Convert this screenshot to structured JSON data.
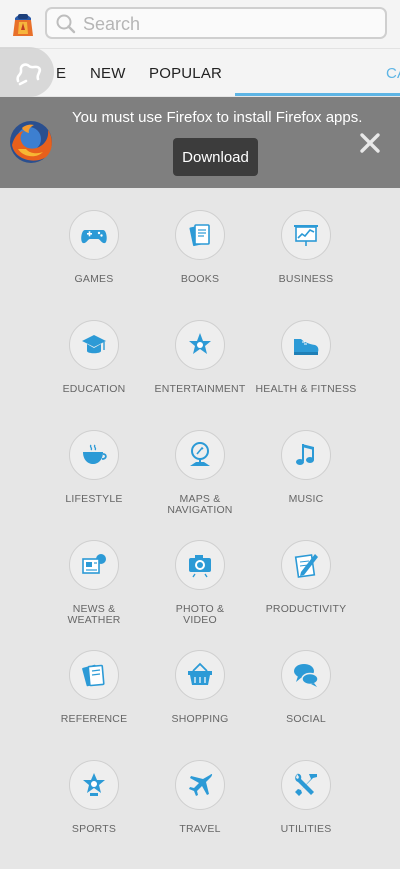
{
  "search": {
    "placeholder": "Search",
    "icon": "search-icon"
  },
  "tabs": [
    {
      "label": "E"
    },
    {
      "label": "NEW"
    },
    {
      "label": "POPULAR"
    },
    {
      "label": "CA"
    }
  ],
  "banner": {
    "message": "You must use Firefox to install Firefox apps.",
    "download_label": "Download"
  },
  "categories": [
    {
      "label": "GAMES",
      "icon": "gamepad-icon"
    },
    {
      "label": "BOOKS",
      "icon": "book-icon"
    },
    {
      "label": "BUSINESS",
      "icon": "chart-icon"
    },
    {
      "label": "EDUCATION",
      "icon": "graduation-cap-icon"
    },
    {
      "label": "ENTERTAINMENT",
      "icon": "star-icon"
    },
    {
      "label": "HEALTH & FITNESS",
      "icon": "sneaker-icon"
    },
    {
      "label": "LIFESTYLE",
      "icon": "cup-icon"
    },
    {
      "label": "MAPS & NAVIGATION",
      "icon": "map-pin-icon"
    },
    {
      "label": "MUSIC",
      "icon": "music-note-icon"
    },
    {
      "label": "NEWS & WEATHER",
      "icon": "newspaper-icon"
    },
    {
      "label": "PHOTO & VIDEO",
      "icon": "camera-icon"
    },
    {
      "label": "PRODUCTIVITY",
      "icon": "pencil-icon"
    },
    {
      "label": "REFERENCE",
      "icon": "reference-book-icon"
    },
    {
      "label": "SHOPPING",
      "icon": "basket-icon"
    },
    {
      "label": "SOCIAL",
      "icon": "chat-bubbles-icon"
    },
    {
      "label": "SPORTS",
      "icon": "trophy-star-icon"
    },
    {
      "label": "TRAVEL",
      "icon": "airplane-icon"
    },
    {
      "label": "UTILITIES",
      "icon": "tools-icon"
    }
  ],
  "colors": {
    "accent": "#2c9ad6",
    "banner_bg": "#7f7f7f",
    "page_bg": "#e6e6e6"
  }
}
